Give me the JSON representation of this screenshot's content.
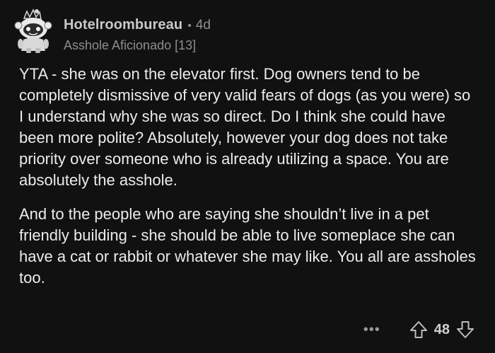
{
  "comment": {
    "author": "Hotelroombureau",
    "separator": "•",
    "age": "4d",
    "flair": "Asshole Aficionado [13]",
    "paragraphs": [
      "YTA - she was on the elevator first. Dog owners tend to be completely dismissive of very valid fears of dogs (as you were) so I understand why she was so direct. Do I think she could have been more polite? Absolutely, however your dog does not take priority over someone who is already utilizing a space. You are absolutely the asshole.",
      "And to the people who are saying she shouldn’t live in a pet friendly building - she should be able to live someplace she can have a cat or rabbit or whatever she may like. You all are assholes too."
    ],
    "score": "48",
    "more_label": "•••"
  },
  "icons": {
    "avatar": "snoo-avatar-icon",
    "upvote": "upvote-arrow-icon",
    "downvote": "downvote-arrow-icon",
    "more": "more-options-icon"
  },
  "colors": {
    "background": "#111111",
    "text": "#ececec",
    "muted": "#8d8d8d"
  }
}
